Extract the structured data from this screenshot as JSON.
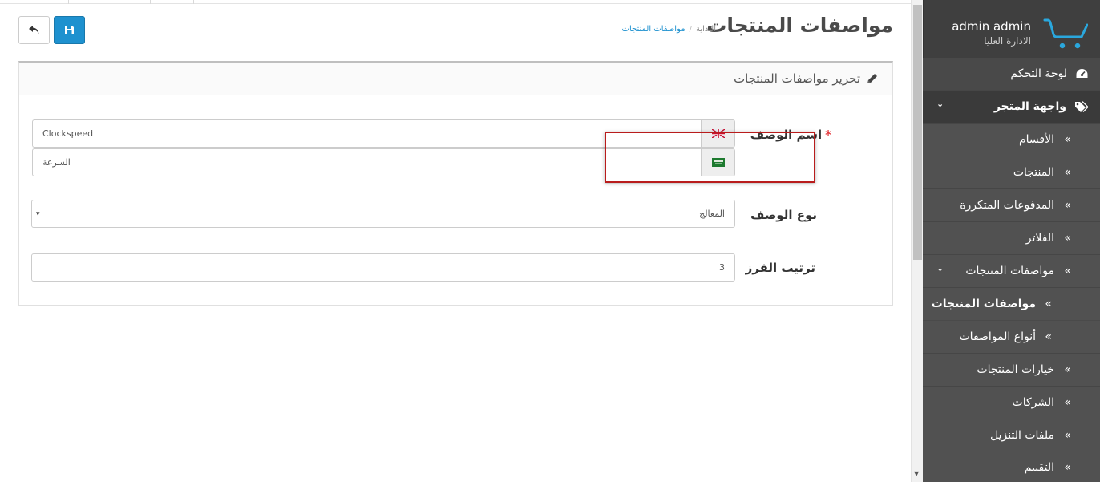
{
  "header": {
    "title": "مواصفات المنتجات",
    "breadcrumb": [
      "البداية",
      "مواصفات المنتجات"
    ]
  },
  "buttons": {
    "back_icon": "reply-icon",
    "save_icon": "save-icon"
  },
  "panel": {
    "title": "تحرير مواصفات المنتجات"
  },
  "form": {
    "name": {
      "label": "اسم الوصف",
      "required_mark": "*",
      "values": [
        {
          "value": "Clockspeed",
          "flag": "uk-flag-icon"
        },
        {
          "value": "السرعة",
          "flag": "sa-flag-icon"
        }
      ]
    },
    "group": {
      "label": "نوع الوصف",
      "selected": "المعالج",
      "arrow": "▾"
    },
    "sort_order": {
      "label": "ترتيب الفرز",
      "value": "3"
    }
  },
  "sidebar": {
    "user_name": "admin admin",
    "user_role": "الادارة العليا",
    "items": [
      {
        "label": "لوحة التحكم",
        "icon": "dashboard-icon",
        "type": "dash"
      },
      {
        "label": "واجهة المتجر",
        "icon": "tags-icon",
        "type": "active",
        "expanded": "⌄"
      },
      {
        "label": "الأقسام",
        "type": "sub",
        "chevron": "»"
      },
      {
        "label": "المنتجات",
        "type": "sub",
        "chevron": "»"
      },
      {
        "label": "المدفوعات المتكررة",
        "type": "sub",
        "chevron": "»"
      },
      {
        "label": "الفلاتر",
        "type": "sub",
        "chevron": "»"
      },
      {
        "label": "مواصفات المنتجات",
        "type": "sub",
        "chevron": "»",
        "expanded": "⌄"
      },
      {
        "label": "مواصفات المنتجات",
        "type": "subsub-current",
        "chevron": "»"
      },
      {
        "label": "أنواع المواصفات",
        "type": "subsub",
        "chevron": "»"
      },
      {
        "label": "خيارات المنتجات",
        "type": "sub",
        "chevron": "»"
      },
      {
        "label": "الشركات",
        "type": "sub",
        "chevron": "»"
      },
      {
        "label": "ملفات التنزيل",
        "type": "sub",
        "chevron": "»"
      },
      {
        "label": "التقييم",
        "type": "sub",
        "chevron": "»"
      }
    ]
  },
  "colors": {
    "primary": "#1e91cf",
    "sidebar_bg": "#515151",
    "sidebar_header": "#3f3f3f",
    "highlight": "#b91c1c",
    "required": "#e3353a"
  }
}
